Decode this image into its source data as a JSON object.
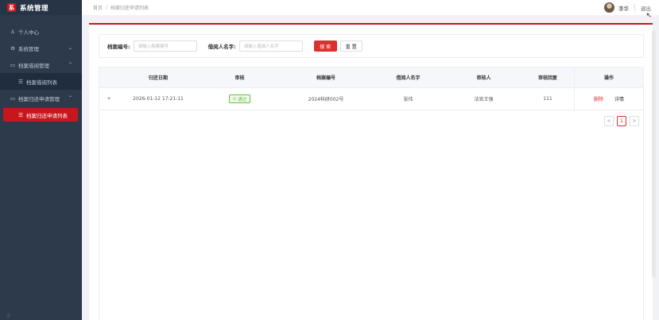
{
  "brand": {
    "logo_char": "系",
    "title": "系统管理"
  },
  "sidebar": {
    "items": [
      {
        "label": "个人中心",
        "icon": "user-icon"
      },
      {
        "label": "系统管理",
        "icon": "gear-icon"
      },
      {
        "label": "档案借阅管理",
        "icon": "folder-icon"
      },
      {
        "label": "档案借阅列表",
        "icon": "list-icon"
      },
      {
        "label": "档案归还申请管理",
        "icon": "folder-icon"
      },
      {
        "label": "档案归还申请列表",
        "icon": "list-icon"
      }
    ],
    "footer": "◎"
  },
  "topbar": {
    "breadcrumb_home": "首页",
    "breadcrumb_sep": "/",
    "breadcrumb_current": "档案归还申请列表",
    "username": "李华",
    "logout": "退出"
  },
  "search": {
    "archive_no_label": "档案编号:",
    "archive_no_placeholder": "请输入档案编号",
    "borrower_label": "借阅人名字:",
    "borrower_placeholder": "请输入借阅人名字",
    "search_button": "搜 索",
    "reset_button": "重 置"
  },
  "table": {
    "headers": [
      "归还日期",
      "审核",
      "档案编号",
      "借阅人名字",
      "审核人",
      "审核回复",
      "操作"
    ],
    "rows": [
      {
        "expand": "+",
        "return_date": "2026-01-12 17:21:11",
        "audit_status": "通过",
        "archive_no": "2024科研002号",
        "borrower": "张伟",
        "auditor": "法官王强",
        "reply": "111",
        "op_delete": "删除",
        "op_detail": "详情"
      }
    ]
  },
  "pagination": {
    "prev": "<",
    "current_page": "1",
    "next": ">"
  },
  "colors": {
    "accent": "#c8161d",
    "sidebar_bg": "#2d3a4b",
    "success": "#67c23a"
  }
}
